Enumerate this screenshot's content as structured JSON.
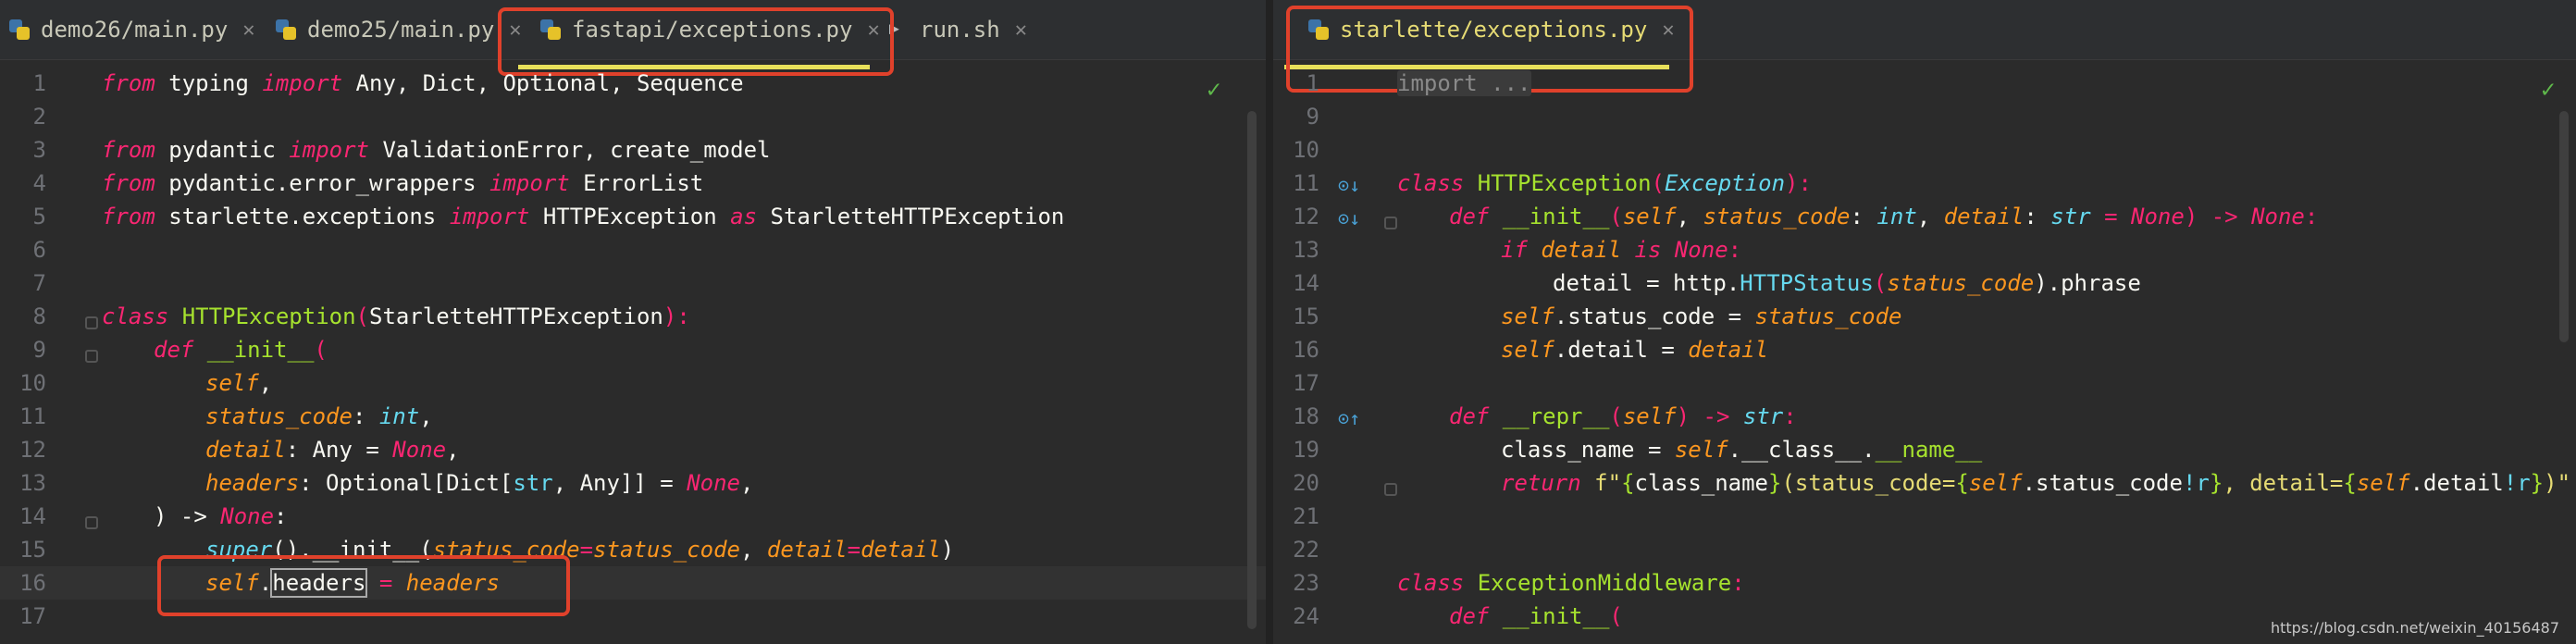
{
  "left_tabs": [
    {
      "label": "demo26/main.py",
      "icon": "python-file-icon"
    },
    {
      "label": "demo25/main.py",
      "icon": "python-file-icon"
    },
    {
      "label": "fastapi/exceptions.py",
      "icon": "python-file-icon",
      "active": true
    },
    {
      "label": "run.sh",
      "icon": "shell-script-icon"
    }
  ],
  "right_tabs": [
    {
      "label": "starlette/exceptions.py",
      "icon": "python-file-icon",
      "active": true
    }
  ],
  "left_lines": [
    {
      "n": "1"
    },
    {
      "n": "2"
    },
    {
      "n": "3"
    },
    {
      "n": "4"
    },
    {
      "n": "5"
    },
    {
      "n": "6"
    },
    {
      "n": "7"
    },
    {
      "n": "8"
    },
    {
      "n": "9"
    },
    {
      "n": "10"
    },
    {
      "n": "11"
    },
    {
      "n": "12"
    },
    {
      "n": "13"
    },
    {
      "n": "14"
    },
    {
      "n": "15"
    },
    {
      "n": "16"
    },
    {
      "n": "17"
    }
  ],
  "right_lines": [
    {
      "n": "1"
    },
    {
      "n": "9"
    },
    {
      "n": "10"
    },
    {
      "n": "11"
    },
    {
      "n": "12"
    },
    {
      "n": "13"
    },
    {
      "n": "14"
    },
    {
      "n": "15"
    },
    {
      "n": "16"
    },
    {
      "n": "17"
    },
    {
      "n": "18"
    },
    {
      "n": "19"
    },
    {
      "n": "20"
    },
    {
      "n": "21"
    },
    {
      "n": "22"
    },
    {
      "n": "23"
    },
    {
      "n": "24"
    }
  ],
  "left_code": {
    "l1": {
      "from": "from",
      "mod": " typing ",
      "imp": "import",
      "rest": " Any, Dict, Optional, Sequence"
    },
    "l3": {
      "from": "from",
      "mod": " pydantic ",
      "imp": "import",
      "rest": " ValidationError, create_model"
    },
    "l4": {
      "from": "from",
      "mod": " pydantic.error_wrappers ",
      "imp": "import",
      "rest": " ErrorList"
    },
    "l5": {
      "from": "from",
      "mod": " starlette.exceptions ",
      "imp": "import",
      "name": " HTTPException ",
      "as": "as",
      "alias": " StarletteHTTPException"
    },
    "l8": {
      "class": "class",
      "name": " HTTPException",
      "paren": "(",
      "base": "StarletteHTTPException",
      "end": "):"
    },
    "l9": {
      "def": "def",
      "name": " __init__",
      "paren": "("
    },
    "l10": {
      "self": "self",
      "comma": ","
    },
    "l11": {
      "arg": "status_code",
      "colon": ": ",
      "type": "int",
      "comma": ","
    },
    "l12": {
      "arg": "detail",
      "colon": ": Any = ",
      "val": "None",
      "comma": ","
    },
    "l13": {
      "arg": "headers",
      "colon": ": Optional[Dict[",
      "t1": "str",
      "mid": ", Any]] = ",
      "val": "None",
      "comma": ","
    },
    "l14": {
      "close": ") -> ",
      "ret": "None",
      "colon": ":"
    },
    "l15": {
      "super": "super",
      "call": "().__init__(",
      "a1": "status_code",
      "eq": "=",
      "a2": "status_code",
      "c": ", ",
      "a3": "detail",
      "eq2": "=",
      "a4": "detail",
      "end": ")"
    },
    "l16": {
      "self": "self",
      "dot": ".",
      "attr": "headers",
      "eq": " = ",
      "val": "headers"
    }
  },
  "right_code": {
    "l1": {
      "fold": "import ..."
    },
    "l11": {
      "class": "class",
      "name": " HTTPException",
      "paren": "(",
      "base": "Exception",
      "end": "):"
    },
    "l12": {
      "def": "def",
      "name": " __init__",
      "paren": "(",
      "self": "self",
      "c1": ", ",
      "a1": "status_code",
      "col": ": ",
      "t1": "int",
      "c2": ", ",
      "a2": "detail",
      "col2": ": ",
      "t2": "str",
      "eq": " = ",
      "none": "None",
      "arrow": ") -> ",
      "ret": "None",
      "end": ":"
    },
    "l13": {
      "if": "if",
      "sp": " ",
      "v": "detail",
      "is": " is ",
      "none": "None",
      "end": ":"
    },
    "l14": {
      "lhs": "detail = http.",
      "cls": "HTTPStatus",
      "p": "(",
      "arg": "status_code",
      "rest": ").phrase"
    },
    "l15": {
      "self": "self",
      "attr": ".status_code = ",
      "val": "status_code"
    },
    "l16": {
      "self": "self",
      "attr": ".detail = ",
      "val": "detail"
    },
    "l18": {
      "def": "def",
      "name": " __repr__",
      "p": "(",
      "self": "self",
      "arrow": ") -> ",
      "ret": "str",
      "end": ":"
    },
    "l19": {
      "lhs": "class_name = ",
      "self": "self",
      "rest": ".__class__.",
      "dunder": "__name__"
    },
    "l20": {
      "ret": "return",
      "f": " f",
      "s1": "\"",
      "b1": "{",
      "v1": "class_name",
      "b2": "}",
      "s2": "(status_code=",
      "b3": "{",
      "self1": "self",
      "v2": ".status_code",
      "conv1": "!r",
      "b4": "}",
      "s3": ", detail=",
      "b5": "{",
      "self2": "self",
      "v3": ".detail",
      "conv2": "!r",
      "b6": "}",
      "s4": ")\""
    },
    "l23": {
      "class": "class",
      "name": " ExceptionMiddleware",
      "end": ":"
    },
    "l24": {
      "def": "def",
      "name": " __init__",
      "p": "("
    }
  },
  "watermark": "https://blog.csdn.net/weixin_40156487",
  "colors": {
    "accent_yellow": "#e8e05a",
    "highlight_red": "#e0412b",
    "keyword": "#f92672",
    "function": "#a6e22e",
    "param": "#fd971f",
    "builtin": "#66d9ef"
  }
}
